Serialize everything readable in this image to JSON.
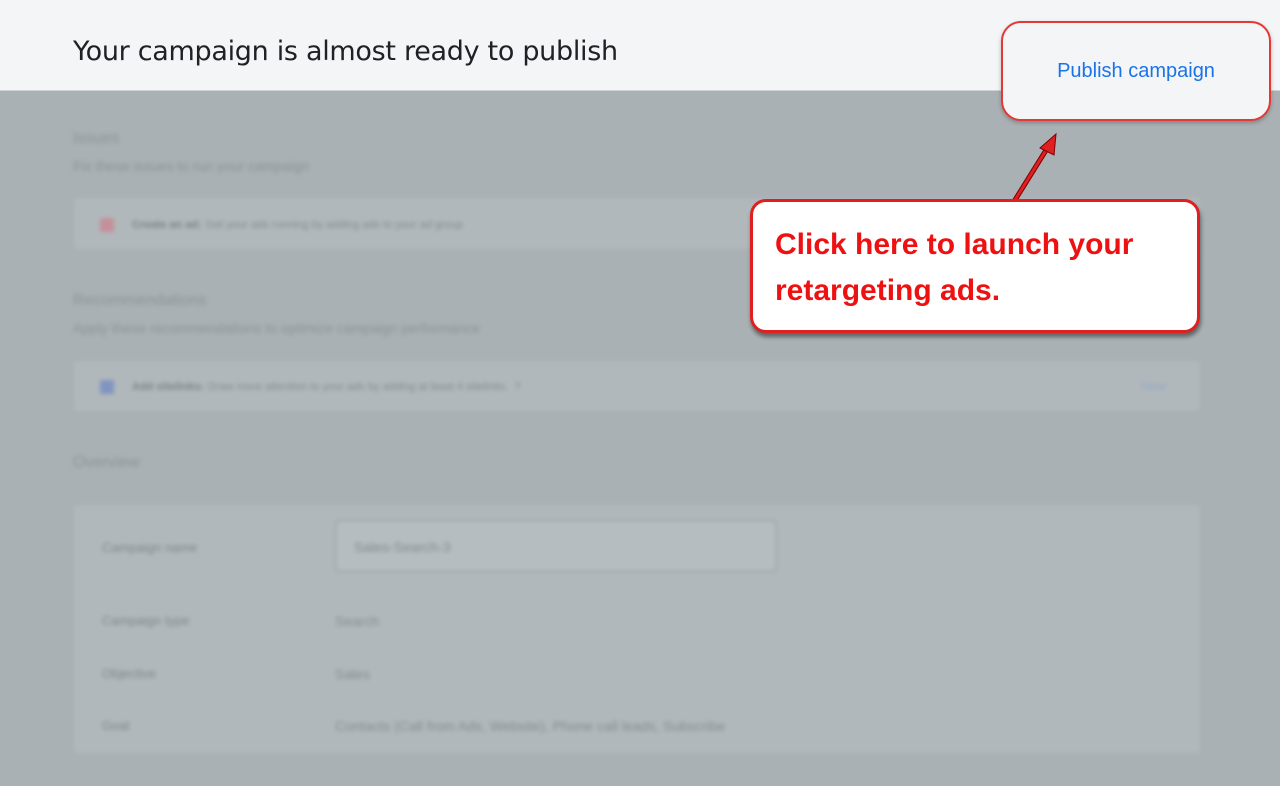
{
  "header": {
    "title": "Your campaign is almost ready to publish",
    "publish_label": "Publish campaign"
  },
  "issues": {
    "title": "Issues",
    "subtitle": "Fix these issues to run your campaign",
    "item": {
      "icon": "wrench-icon",
      "bold": "Create an ad:",
      "text": "Get your ads running by adding ads to your ad group"
    }
  },
  "recommendations": {
    "title": "Recommendations",
    "subtitle": "Apply these recommendations to optimize campaign performance",
    "item": {
      "icon": "sitelinks-icon",
      "bold": "Add sitelinks:",
      "text": "Draw more attention to your ads by adding at least 4 sitelinks.",
      "help": "?",
      "action": "View"
    }
  },
  "overview": {
    "title": "Overview",
    "campaign_name_label": "Campaign name",
    "campaign_name_value": "Sales-Search-3",
    "campaign_type_label": "Campaign type",
    "campaign_type_value": "Search",
    "objective_label": "Objective",
    "objective_value": "Sales",
    "goal_label": "Goal",
    "goal_value": "Contacts (Call from Ads, Website), Phone call leads, Subscribe"
  },
  "callout": {
    "text": "Click here to launch your retargeting ads."
  },
  "colors": {
    "accent": "#1a73e8",
    "highlight": "#e53935",
    "overlay": "#aab1b4"
  }
}
